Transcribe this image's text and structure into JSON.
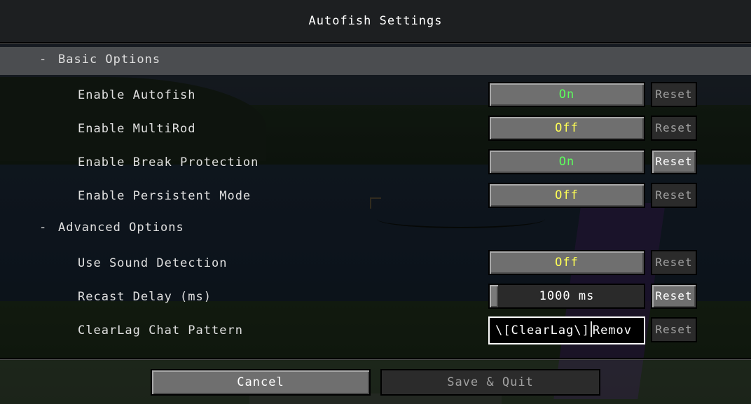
{
  "screen": {
    "title": "Autofish Settings"
  },
  "categories": [
    {
      "collapse_symbol": "-",
      "label": "Basic Options",
      "options": [
        {
          "label": "Enable Autofish",
          "value": "On",
          "reset": "Reset"
        },
        {
          "label": "Enable MultiRod",
          "value": "Off",
          "reset": "Reset"
        },
        {
          "label": "Enable Break Protection",
          "value": "On",
          "reset": "Reset"
        },
        {
          "label": "Enable Persistent Mode",
          "value": "Off",
          "reset": "Reset"
        }
      ]
    },
    {
      "collapse_symbol": "-",
      "label": "Advanced Options",
      "options": [
        {
          "label": "Use Sound Detection",
          "value": "Off",
          "reset": "Reset"
        },
        {
          "label": "Recast Delay (ms)",
          "value": "1000 ms",
          "reset": "Reset"
        },
        {
          "label": "ClearLag Chat Pattern",
          "value_before_caret": "\\[ClearLag\\]",
          "value_after_caret": "Remov",
          "reset": "Reset"
        }
      ]
    }
  ],
  "footer": {
    "cancel_label": "Cancel",
    "save_label": "Save & Quit"
  },
  "colors": {
    "on": "#5dff5d",
    "off": "#ffff55",
    "text": "#e0e0e0",
    "disabled": "#a0a0a0"
  }
}
